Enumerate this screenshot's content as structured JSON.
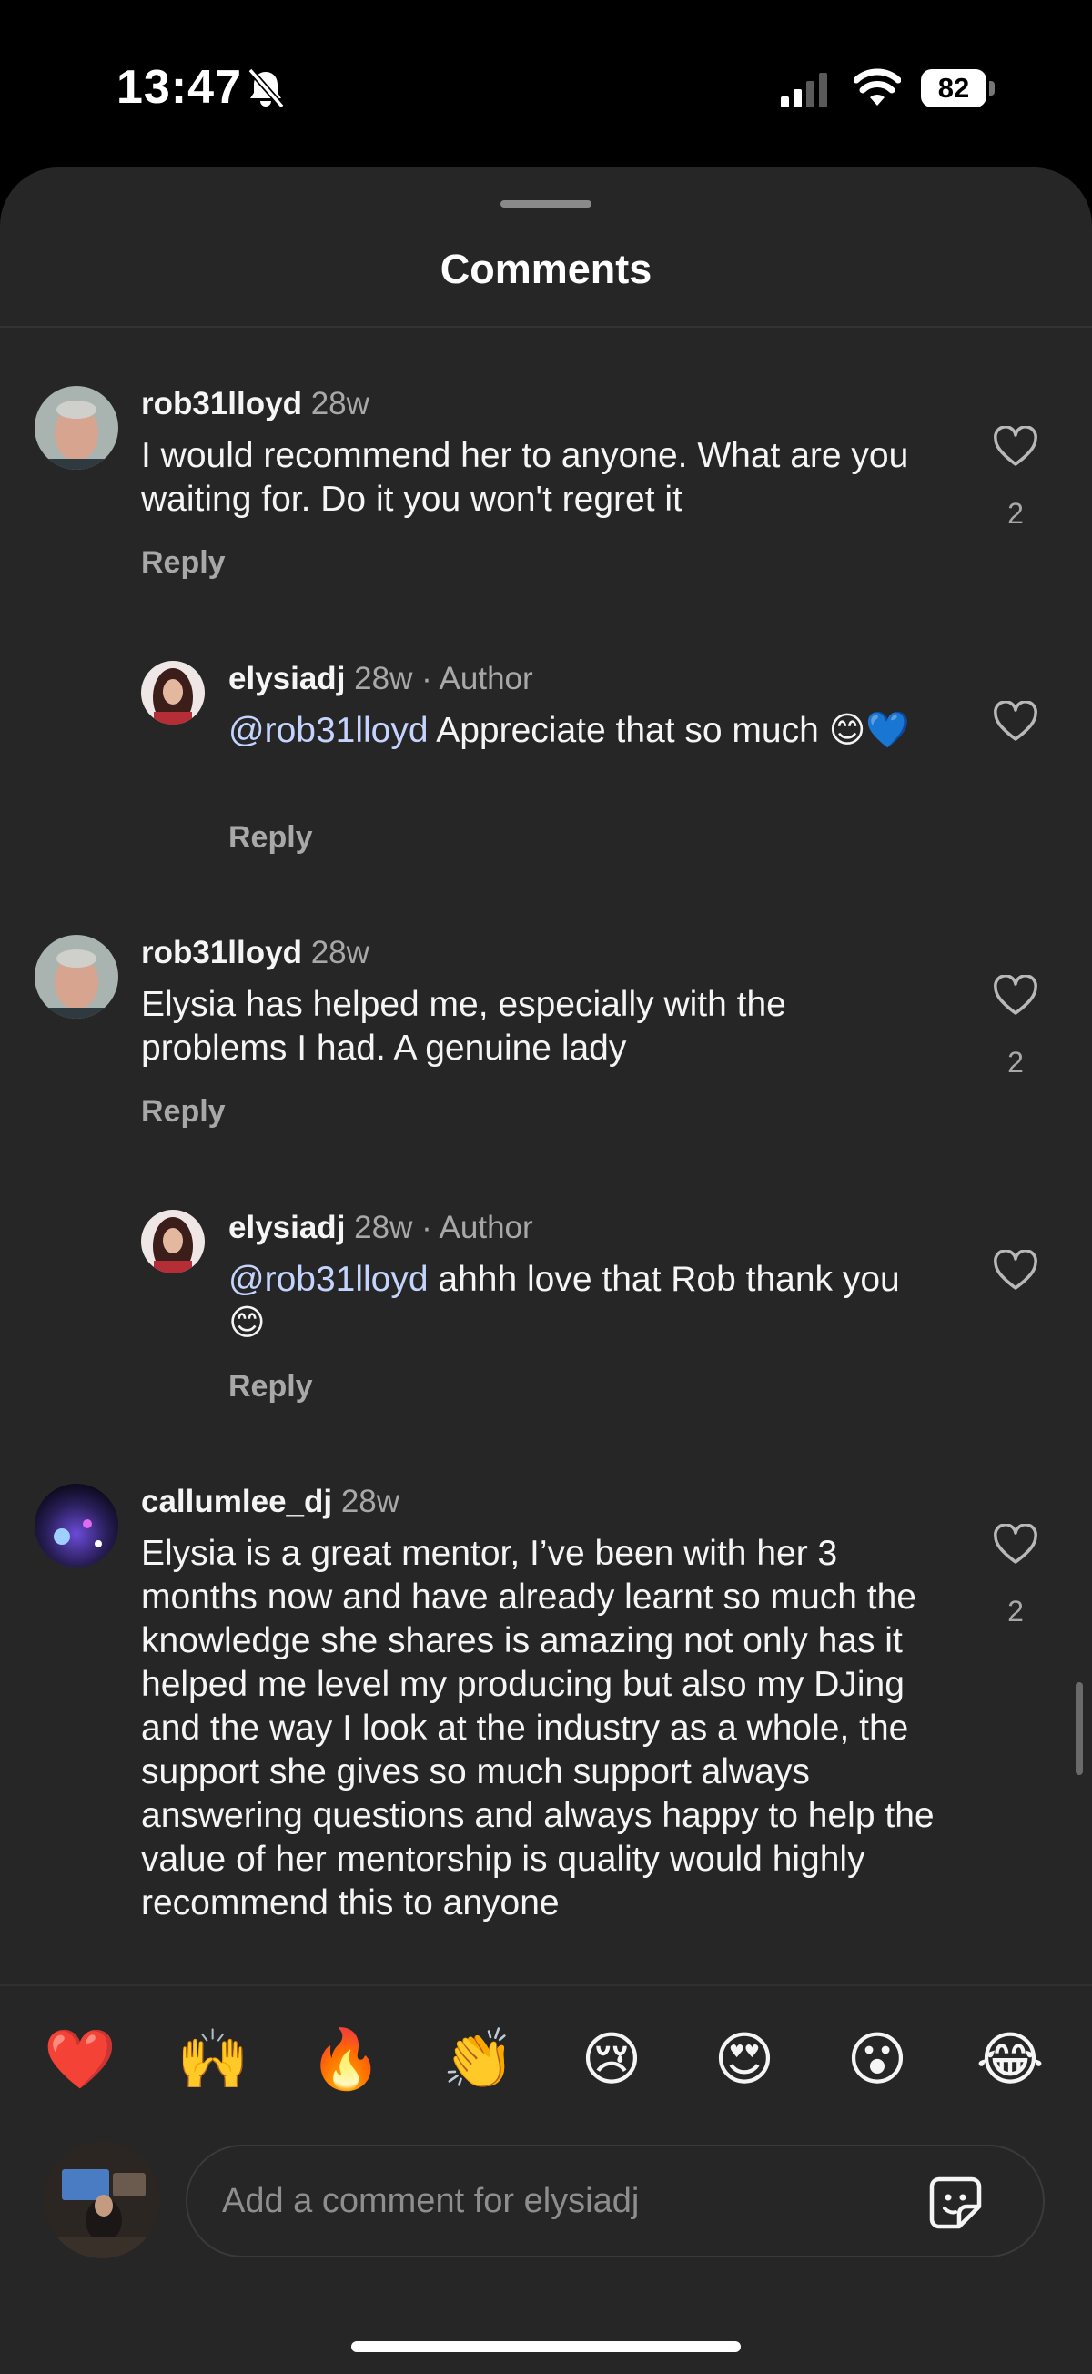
{
  "status_bar": {
    "time": "13:47",
    "battery": "82"
  },
  "header": {
    "title": "Comments"
  },
  "comments": [
    {
      "username": "rob31lloyd",
      "time": "28w",
      "text": "I would recommend her to anyone. What are you waiting for. Do it you won't regret it",
      "reply_label": "Reply",
      "likes": "2"
    },
    {
      "username": "elysiadj",
      "time": "28w",
      "author_tag": "· Author",
      "mention": "@rob31lloyd",
      "text": " Appreciate that so much 😊💙",
      "reply_label": "Reply"
    },
    {
      "username": "rob31lloyd",
      "time": "28w",
      "text": "Elysia has helped me, especially with the problems I had. A genuine lady",
      "reply_label": "Reply",
      "likes": "2"
    },
    {
      "username": "elysiadj",
      "time": "28w",
      "author_tag": "· Author",
      "mention": "@rob31lloyd",
      "text": " ahhh love that Rob thank you 😊",
      "reply_label": "Reply"
    },
    {
      "username": "callumlee_dj",
      "time": "28w",
      "text": "Elysia is a great mentor, I’ve been with her 3 months now and have already learnt so much the knowledge she shares is amazing not only has it helped me level my producing but also my DJing and the way I look at the industry as a whole, the support she gives so much support always answering questions and always happy to help the value of her mentorship is quality would highly recommend this to anyone",
      "likes": "2"
    }
  ],
  "emoji_bar": [
    "❤️",
    "🙌",
    "🔥",
    "👏",
    "😢",
    "😍",
    "😮",
    "😂"
  ],
  "composer": {
    "placeholder": "Add a comment for elysiadj"
  }
}
